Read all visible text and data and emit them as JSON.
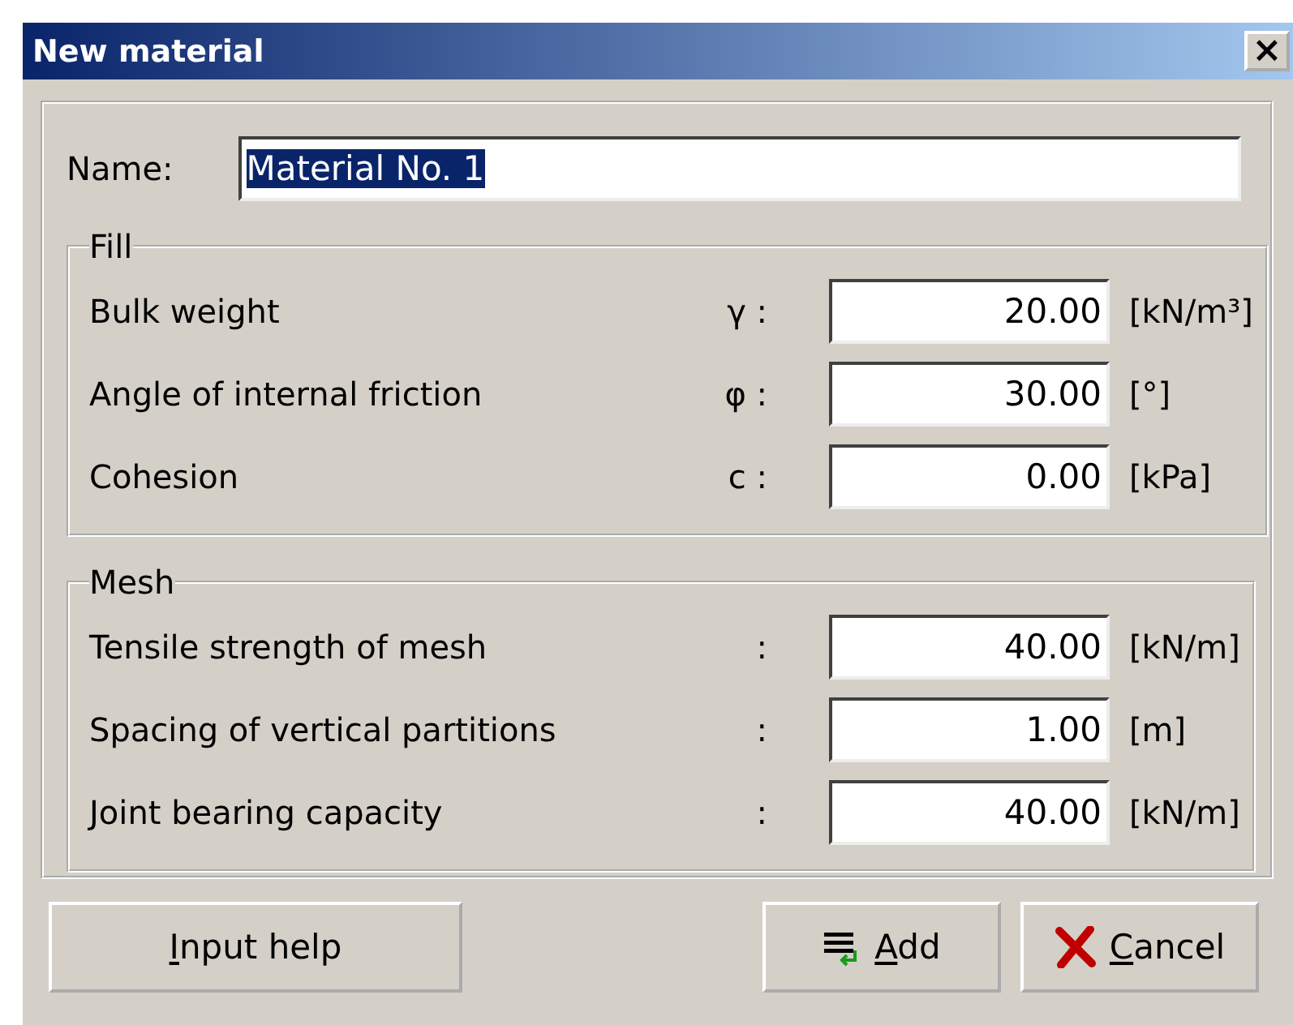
{
  "window": {
    "title": "New material",
    "close": "×"
  },
  "name_field": {
    "label": "Name:",
    "value": "Material No. 1",
    "text_selected": true
  },
  "groups": [
    {
      "title": "Fill",
      "rows": [
        {
          "label": "Bulk weight",
          "symbol": "γ :",
          "value": "20.00",
          "unit": "[kN/m³]"
        },
        {
          "label": "Angle of internal friction",
          "symbol": "φ :",
          "value": "30.00",
          "unit": "[°]"
        },
        {
          "label": "Cohesion",
          "symbol": "c :",
          "value": "0.00",
          "unit": "[kPa]"
        }
      ]
    },
    {
      "title": "Mesh",
      "rows": [
        {
          "label": "Tensile strength of mesh",
          "symbol": ":",
          "value": "40.00",
          "unit": "[kN/m]"
        },
        {
          "label": "Spacing of vertical partitions",
          "symbol": ":",
          "value": "1.00",
          "unit": "[m]"
        },
        {
          "label": "Joint bearing capacity",
          "symbol": ":",
          "value": "40.00",
          "unit": "[kN/m]"
        }
      ]
    }
  ],
  "buttons": [
    {
      "label": "Input help",
      "kind": "help"
    },
    {
      "label": "Add",
      "kind": "add"
    },
    {
      "label": "Cancel",
      "kind": "cancel"
    }
  ]
}
